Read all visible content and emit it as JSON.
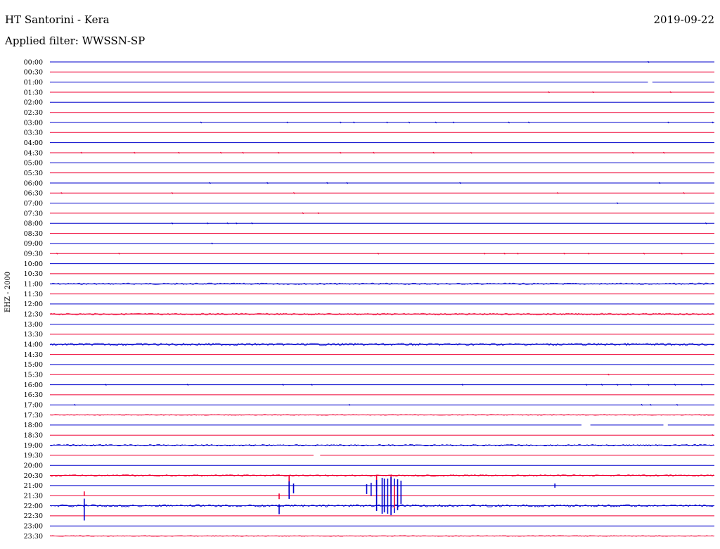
{
  "header": {
    "station": "HT Santorini - Kera",
    "date": "2019-09-22",
    "filter_label": "Applied filter: WWSSN-SP",
    "channel": "EHZ - 2000"
  },
  "colors": {
    "trace_a": "#0000cc",
    "trace_b": "#ee0033",
    "text": "#000000",
    "background": "#ffffff"
  },
  "chart_data": {
    "type": "line",
    "kind": "helicorder",
    "ylabel": "EHZ - 2000",
    "row_labels": [
      "00:00",
      "00:30",
      "01:00",
      "01:30",
      "02:00",
      "02:30",
      "03:00",
      "03:30",
      "04:00",
      "04:30",
      "05:00",
      "05:30",
      "06:00",
      "06:30",
      "07:00",
      "07:30",
      "08:00",
      "08:30",
      "09:00",
      "09:30",
      "10:00",
      "10:30",
      "11:00",
      "11:30",
      "12:00",
      "12:30",
      "13:00",
      "13:30",
      "14:00",
      "14:30",
      "15:00",
      "15:30",
      "16:00",
      "16:30",
      "17:00",
      "17:30",
      "18:00",
      "18:30",
      "19:00",
      "19:30",
      "20:00",
      "20:30",
      "21:00",
      "21:30",
      "22:00",
      "22:30",
      "23:00",
      "23:30"
    ],
    "row_duration_minutes": 30,
    "row_colors_cycle": [
      "#0000cc",
      "#ee0033"
    ],
    "noise_level_by_row": [
      0,
      0,
      0,
      0,
      0,
      0,
      0,
      0,
      0,
      0,
      0,
      0,
      0,
      0,
      0,
      0,
      0,
      0,
      0,
      0,
      0,
      0,
      2,
      0,
      0,
      2,
      0,
      0,
      3,
      0,
      0,
      0,
      0,
      0,
      0,
      1,
      0,
      0,
      2,
      0,
      0,
      2,
      0,
      0,
      3,
      0,
      0,
      1
    ],
    "gaps": [
      {
        "row": "01:00",
        "start_min": 27.0,
        "end_min": 27.2
      },
      {
        "row": "18:00",
        "start_min": 24.0,
        "end_min": 24.4
      },
      {
        "row": "18:00",
        "start_min": 27.7,
        "end_min": 27.9
      },
      {
        "row": "19:30",
        "start_min": 11.9,
        "end_min": 12.2
      }
    ],
    "events": [
      {
        "row": "21:30",
        "minute": 1.55,
        "up": 0.6,
        "down": 0.0
      },
      {
        "row": "22:00",
        "minute": 1.55,
        "up": 1.0,
        "down": 2.1
      },
      {
        "row": "21:30",
        "minute": 10.35,
        "up": 0.3,
        "down": 0.5
      },
      {
        "row": "22:00",
        "minute": 10.35,
        "up": 0.2,
        "down": 1.2
      },
      {
        "row": "20:30",
        "minute": 10.8,
        "up": 0.0,
        "down": 2.5
      },
      {
        "row": "21:00",
        "minute": 10.8,
        "up": 0.6,
        "down": 1.9
      },
      {
        "row": "21:00",
        "minute": 11.0,
        "up": 0.3,
        "down": 1.1
      },
      {
        "row": "21:00",
        "minute": 14.3,
        "up": 0.2,
        "down": 1.2
      },
      {
        "row": "21:00",
        "minute": 14.5,
        "up": 0.4,
        "down": 1.5
      },
      {
        "row": "20:30",
        "minute": 14.75,
        "up": 0.0,
        "down": 2.3
      },
      {
        "row": "21:00",
        "minute": 14.75,
        "up": 0.8,
        "down": 3.6
      },
      {
        "row": "21:00",
        "minute": 15.0,
        "up": 1.1,
        "down": 4.0
      },
      {
        "row": "21:00",
        "minute": 15.1,
        "up": 1.0,
        "down": 3.8
      },
      {
        "row": "21:00",
        "minute": 15.25,
        "up": 1.0,
        "down": 4.0
      },
      {
        "row": "20:30",
        "minute": 15.4,
        "up": 0.0,
        "down": 2.6
      },
      {
        "row": "21:00",
        "minute": 15.4,
        "up": 1.2,
        "down": 4.2
      },
      {
        "row": "21:00",
        "minute": 15.55,
        "up": 1.0,
        "down": 3.9
      },
      {
        "row": "21:30",
        "minute": 15.55,
        "up": 1.4,
        "down": 1.8
      },
      {
        "row": "21:00",
        "minute": 15.7,
        "up": 0.9,
        "down": 3.5
      },
      {
        "row": "21:00",
        "minute": 15.85,
        "up": 0.7,
        "down": 2.6
      },
      {
        "row": "21:00",
        "minute": 22.8,
        "up": 0.3,
        "down": 0.3
      }
    ],
    "specks": [
      {
        "row": "00:00",
        "minute": 27.0
      },
      {
        "row": "01:30",
        "minute": 22.5
      },
      {
        "row": "01:30",
        "minute": 24.5
      },
      {
        "row": "01:30",
        "minute": 28.0
      },
      {
        "row": "03:00",
        "minute": 6.8
      },
      {
        "row": "03:00",
        "minute": 10.7
      },
      {
        "row": "03:00",
        "minute": 13.1
      },
      {
        "row": "03:00",
        "minute": 13.7
      },
      {
        "row": "03:00",
        "minute": 15.2
      },
      {
        "row": "03:00",
        "minute": 16.2
      },
      {
        "row": "03:00",
        "minute": 17.4
      },
      {
        "row": "03:00",
        "minute": 18.2
      },
      {
        "row": "03:00",
        "minute": 20.7
      },
      {
        "row": "03:00",
        "minute": 21.6
      },
      {
        "row": "03:00",
        "minute": 27.9
      },
      {
        "row": "03:00",
        "minute": 29.9
      },
      {
        "row": "04:30",
        "minute": 1.4
      },
      {
        "row": "04:30",
        "minute": 3.8
      },
      {
        "row": "04:30",
        "minute": 5.8
      },
      {
        "row": "04:30",
        "minute": 7.7
      },
      {
        "row": "04:30",
        "minute": 8.7
      },
      {
        "row": "04:30",
        "minute": 10.3
      },
      {
        "row": "04:30",
        "minute": 13.1
      },
      {
        "row": "04:30",
        "minute": 14.6
      },
      {
        "row": "04:30",
        "minute": 17.3
      },
      {
        "row": "04:30",
        "minute": 19.0
      },
      {
        "row": "04:30",
        "minute": 26.3
      },
      {
        "row": "04:30",
        "minute": 27.7
      },
      {
        "row": "06:00",
        "minute": 7.2
      },
      {
        "row": "06:00",
        "minute": 9.8
      },
      {
        "row": "06:00",
        "minute": 12.5
      },
      {
        "row": "06:00",
        "minute": 13.4
      },
      {
        "row": "06:00",
        "minute": 18.5
      },
      {
        "row": "06:00",
        "minute": 27.5
      },
      {
        "row": "06:30",
        "minute": 0.5
      },
      {
        "row": "06:30",
        "minute": 5.5
      },
      {
        "row": "06:30",
        "minute": 11.0
      },
      {
        "row": "06:30",
        "minute": 22.9
      },
      {
        "row": "06:30",
        "minute": 28.6
      },
      {
        "row": "07:00",
        "minute": 25.6
      },
      {
        "row": "07:30",
        "minute": 11.4
      },
      {
        "row": "07:30",
        "minute": 12.1
      },
      {
        "row": "08:00",
        "minute": 5.5
      },
      {
        "row": "08:00",
        "minute": 7.1
      },
      {
        "row": "08:00",
        "minute": 8.0
      },
      {
        "row": "08:00",
        "minute": 8.4
      },
      {
        "row": "08:00",
        "minute": 9.1
      },
      {
        "row": "08:00",
        "minute": 29.6
      },
      {
        "row": "09:00",
        "minute": 7.3
      },
      {
        "row": "09:30",
        "minute": 0.3
      },
      {
        "row": "09:30",
        "minute": 3.1
      },
      {
        "row": "09:30",
        "minute": 14.8
      },
      {
        "row": "09:30",
        "minute": 19.6
      },
      {
        "row": "09:30",
        "minute": 20.5
      },
      {
        "row": "09:30",
        "minute": 21.1
      },
      {
        "row": "09:30",
        "minute": 23.2
      },
      {
        "row": "09:30",
        "minute": 24.3
      },
      {
        "row": "09:30",
        "minute": 26.8
      },
      {
        "row": "09:30",
        "minute": 28.5
      },
      {
        "row": "15:30",
        "minute": 25.2
      },
      {
        "row": "16:00",
        "minute": 2.5
      },
      {
        "row": "16:00",
        "minute": 6.2
      },
      {
        "row": "16:00",
        "minute": 10.5
      },
      {
        "row": "16:00",
        "minute": 11.8
      },
      {
        "row": "16:00",
        "minute": 18.6
      },
      {
        "row": "16:00",
        "minute": 24.2
      },
      {
        "row": "16:00",
        "minute": 24.9
      },
      {
        "row": "16:00",
        "minute": 25.6
      },
      {
        "row": "16:00",
        "minute": 26.2
      },
      {
        "row": "16:00",
        "minute": 27.0
      },
      {
        "row": "16:00",
        "minute": 28.2
      },
      {
        "row": "16:00",
        "minute": 29.4
      },
      {
        "row": "17:00",
        "minute": 1.1
      },
      {
        "row": "17:00",
        "minute": 13.5
      },
      {
        "row": "17:00",
        "minute": 26.7
      },
      {
        "row": "17:00",
        "minute": 27.1
      },
      {
        "row": "17:00",
        "minute": 28.3
      },
      {
        "row": "18:30",
        "minute": 29.9
      }
    ]
  }
}
